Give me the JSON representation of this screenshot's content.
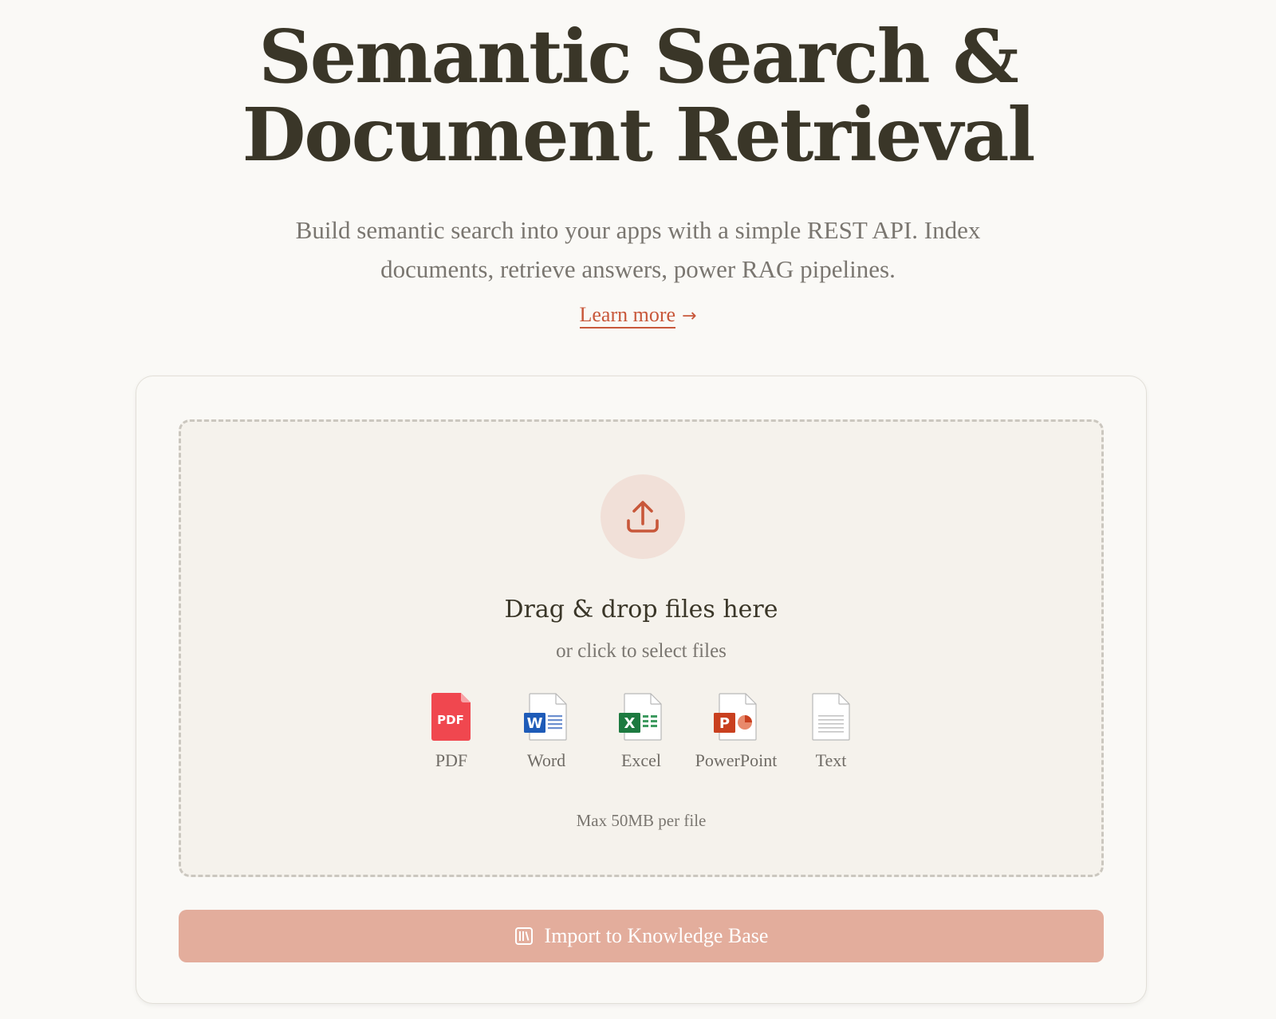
{
  "hero": {
    "title_line1": "Semantic Search &",
    "title_line2": "Document Retrieval",
    "subtitle_line1": "Build semantic search into your apps with a simple REST API. Index",
    "subtitle_line2": "documents, retrieve answers, power RAG pipelines.",
    "learn_more": "Learn more",
    "learn_more_icon": "arrow-right-icon"
  },
  "upload": {
    "icon": "upload-icon",
    "title": "Drag & drop files here",
    "subtitle": "or click to select files",
    "file_types": [
      {
        "label": "PDF",
        "icon": "pdf-file-icon",
        "badge": "PDF",
        "color": "#f0474f"
      },
      {
        "label": "Word",
        "icon": "word-file-icon",
        "badge": "W",
        "color": "#1e5bb8"
      },
      {
        "label": "Excel",
        "icon": "excel-file-icon",
        "badge": "X",
        "color": "#1d7a40"
      },
      {
        "label": "PowerPoint",
        "icon": "powerpoint-file-icon",
        "badge": "P",
        "color": "#c9401f"
      },
      {
        "label": "Text",
        "icon": "text-file-icon"
      }
    ],
    "max_size": "Max 50MB per file"
  },
  "import_button": {
    "label": "Import to Knowledge Base",
    "icon": "library-icon"
  },
  "colors": {
    "accent": "#c8573a",
    "button_bg": "#e3ad9c",
    "background": "#faf9f6",
    "dropzone_bg": "#f5f2ec"
  }
}
